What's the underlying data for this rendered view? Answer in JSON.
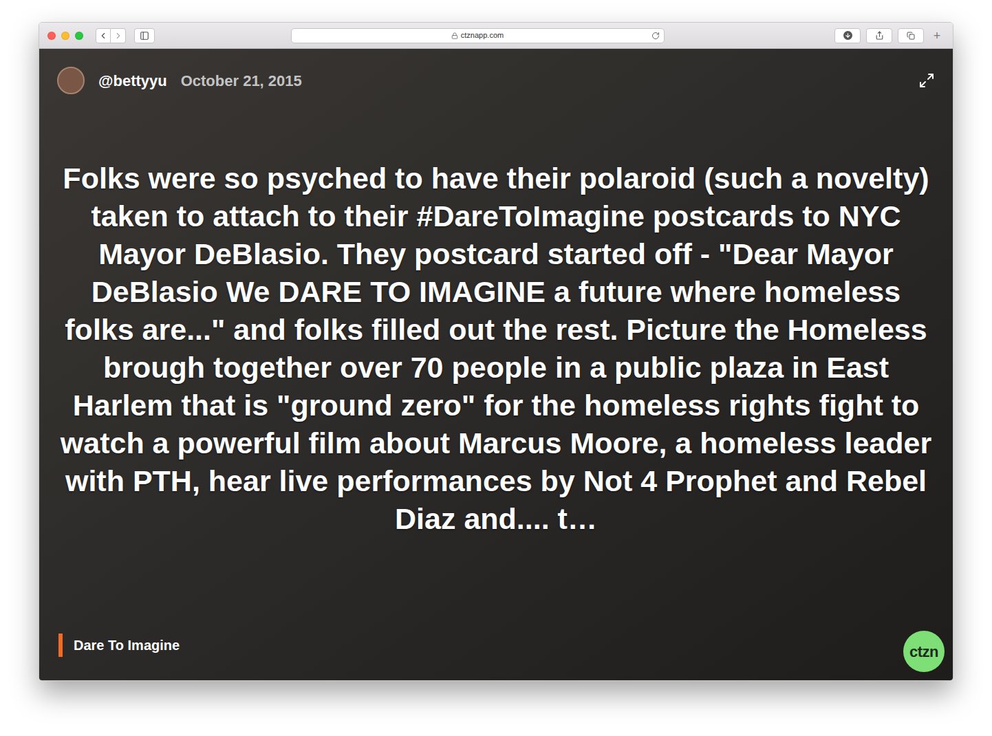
{
  "browser": {
    "url": "ctznapp.com",
    "traffic_lights": [
      {
        "color": "#fe5f57"
      },
      {
        "color": "#febc2e"
      },
      {
        "color": "#28c840"
      }
    ],
    "new_tab": "+"
  },
  "post": {
    "user": "@bettyyu",
    "date": "October 21, 2015",
    "body": "Folks were so psyched to have their polaroid (such a novelty) taken to attach to their #DareToImagine postcards to NYC Mayor DeBlasio. They postcard started off - \"Dear Mayor DeBlasio We DARE TO IMAGINE a future where homeless folks are...\" and folks filled out the rest. Picture the Homeless brough together over 70 people in a public plaza in East Harlem that is \"ground zero\" for the homeless rights fight to watch a powerful film about Marcus Moore, a homeless leader with PTH, hear live performances by Not 4 Prophet and Rebel Diaz and.... t…",
    "tag": "Dare To Imagine",
    "logo": "ctzn"
  }
}
